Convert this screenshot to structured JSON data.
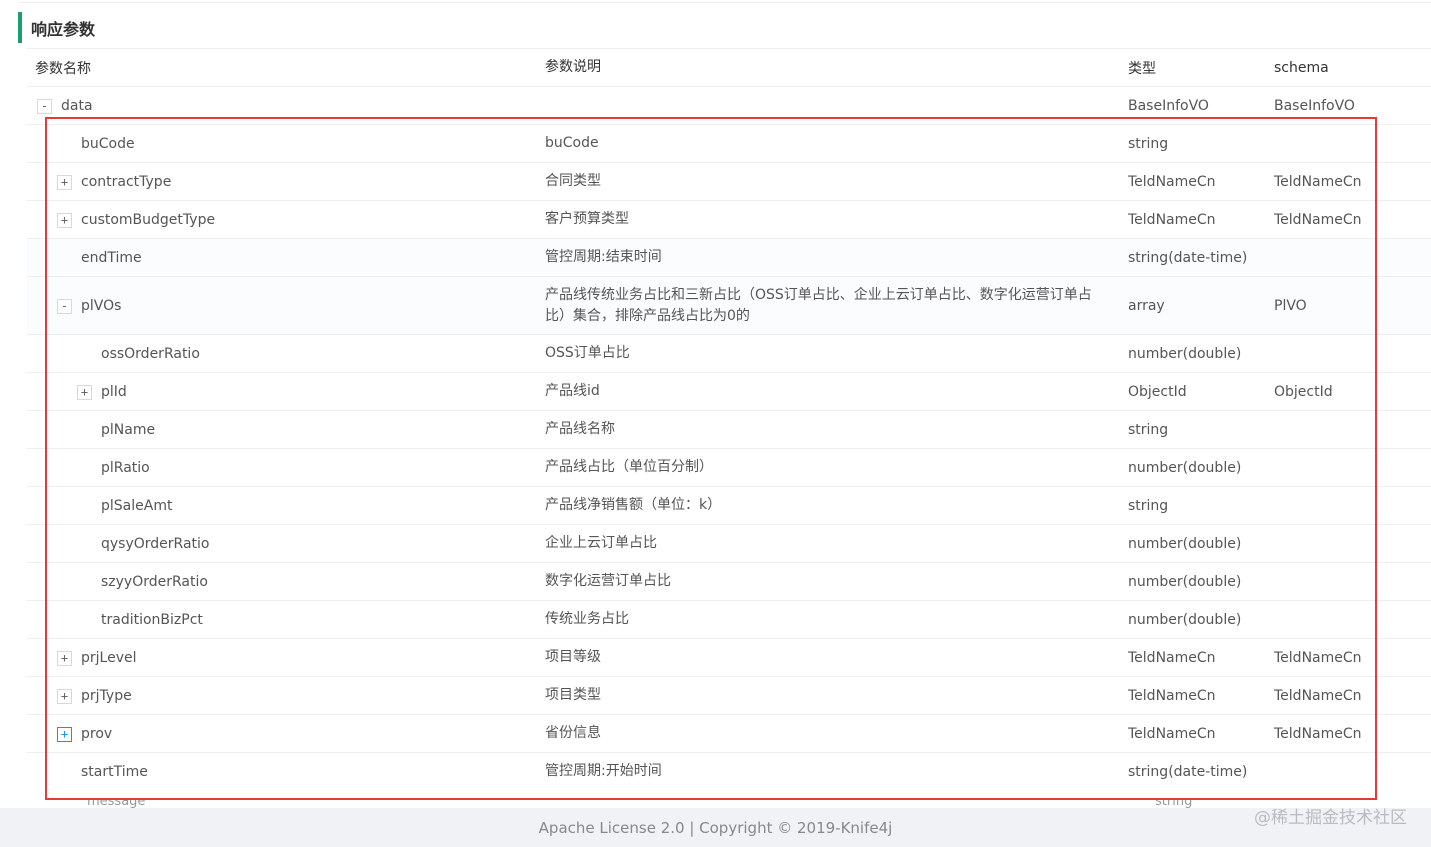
{
  "section_title": "响应参数",
  "columns": {
    "name": "参数名称",
    "desc": "参数说明",
    "type": "类型",
    "schema": "schema"
  },
  "rows": [
    {
      "name": "data",
      "desc": "",
      "type": "BaseInfoVO",
      "schema": "BaseInfoVO",
      "level": 0,
      "toggle": "-"
    },
    {
      "name": "buCode",
      "desc": "buCode",
      "type": "string",
      "schema": "",
      "level": 1,
      "toggle": ""
    },
    {
      "name": "contractType",
      "desc": "合同类型",
      "type": "TeldNameCn",
      "schema": "TeldNameCn",
      "level": 1,
      "toggle": "+"
    },
    {
      "name": "customBudgetType",
      "desc": "客户预算类型",
      "type": "TeldNameCn",
      "schema": "TeldNameCn",
      "level": 1,
      "toggle": "+"
    },
    {
      "name": "endTime",
      "desc": "管控周期:结束时间",
      "type": "string(date-time)",
      "schema": "",
      "level": 1,
      "toggle": ""
    },
    {
      "name": "plVOs",
      "desc": "产品线传统业务占比和三新占比（OSS订单占比、企业上云订单占比、数字化运营订单占比）集合，排除产品线占比为0的",
      "type": "array",
      "schema": "PlVO",
      "level": 1,
      "toggle": "-"
    },
    {
      "name": "ossOrderRatio",
      "desc": "OSS订单占比",
      "type": "number(double)",
      "schema": "",
      "level": 2,
      "toggle": ""
    },
    {
      "name": "plId",
      "desc": "产品线id",
      "type": "ObjectId",
      "schema": "ObjectId",
      "level": 2,
      "toggle": "+"
    },
    {
      "name": "plName",
      "desc": "产品线名称",
      "type": "string",
      "schema": "",
      "level": 2,
      "toggle": ""
    },
    {
      "name": "plRatio",
      "desc": "产品线占比（单位百分制）",
      "type": "number(double)",
      "schema": "",
      "level": 2,
      "toggle": ""
    },
    {
      "name": "plSaleAmt",
      "desc": "产品线净销售额（单位：k）",
      "type": "string",
      "schema": "",
      "level": 2,
      "toggle": ""
    },
    {
      "name": "qysyOrderRatio",
      "desc": "企业上云订单占比",
      "type": "number(double)",
      "schema": "",
      "level": 2,
      "toggle": ""
    },
    {
      "name": "szyyOrderRatio",
      "desc": "数字化运营订单占比",
      "type": "number(double)",
      "schema": "",
      "level": 2,
      "toggle": ""
    },
    {
      "name": "traditionBizPct",
      "desc": "传统业务占比",
      "type": "number(double)",
      "schema": "",
      "level": 2,
      "toggle": ""
    },
    {
      "name": "prjLevel",
      "desc": "项目等级",
      "type": "TeldNameCn",
      "schema": "TeldNameCn",
      "level": 1,
      "toggle": "+"
    },
    {
      "name": "prjType",
      "desc": "项目类型",
      "type": "TeldNameCn",
      "schema": "TeldNameCn",
      "level": 1,
      "toggle": "+"
    },
    {
      "name": "prov",
      "desc": "省份信息",
      "type": "TeldNameCn",
      "schema": "TeldNameCn",
      "level": 1,
      "toggle": "+",
      "active": true
    },
    {
      "name": "startTime",
      "desc": "管控周期:开始时间",
      "type": "string(date-time)",
      "schema": "",
      "level": 1,
      "toggle": ""
    }
  ],
  "partial_row": {
    "name": "message",
    "type": "string"
  },
  "footer": "Apache License 2.0 | Copyright © 2019-Knife4j",
  "watermark": "@稀土掘金技术社区",
  "colors": {
    "accent": "#1aa06d",
    "highlight": "#e03c3c",
    "toggle_active": "#1890ff"
  }
}
